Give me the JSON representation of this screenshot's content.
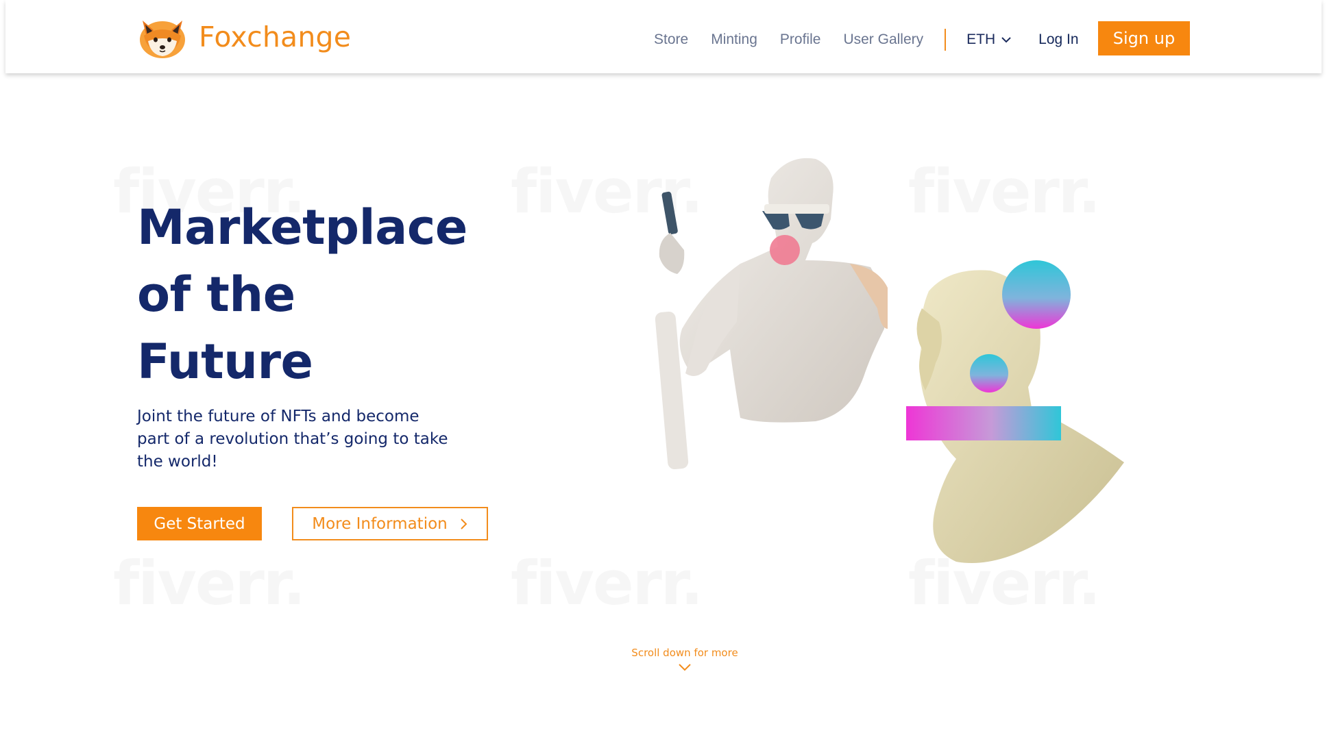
{
  "brand": {
    "name": "Foxchange",
    "logo_icon": "fox-head-icon",
    "accent": "#f7870f",
    "navy": "#14286a"
  },
  "nav": {
    "links": [
      "Store",
      "Minting",
      "Profile",
      "User Gallery"
    ],
    "currency": "ETH",
    "login": "Log In",
    "signup": "Sign up"
  },
  "hero": {
    "title_lines": [
      "Marketplace",
      "of the",
      "Future"
    ],
    "subtitle": "Joint the future of NFTs and become part of a revolution that’s going to take the world!",
    "primary_cta": "Get Started",
    "secondary_cta": "More Information"
  },
  "scroll_hint": "Scroll down for more",
  "watermark": "fiverr."
}
